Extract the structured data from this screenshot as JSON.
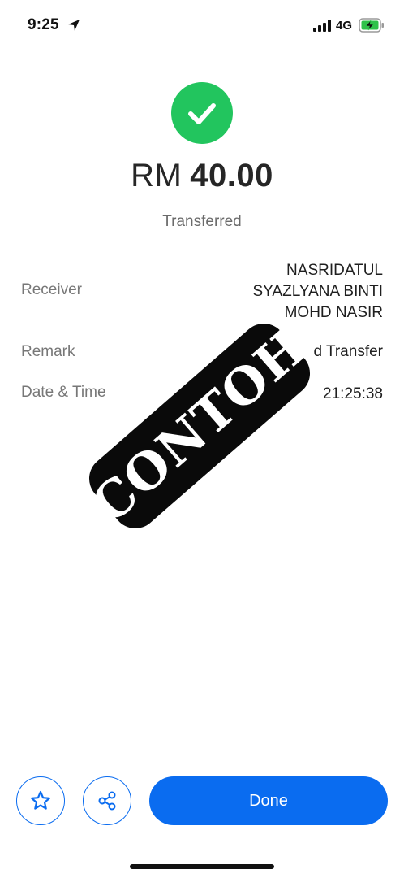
{
  "status_bar": {
    "time": "9:25",
    "network": "4G",
    "icons": [
      "location-arrow-icon",
      "signal-icon",
      "battery-charging-icon"
    ]
  },
  "transaction": {
    "currency": "RM",
    "amount": "40.00",
    "status": "Transferred",
    "success_color": "#22c55e"
  },
  "details": {
    "receiver_label": "Receiver",
    "receiver_lines": [
      "NASRIDATUL",
      "SYAZLYANA BINTI",
      "MOHD NASIR"
    ],
    "remark_label": "Remark",
    "remark_value_visible": "d Transfer",
    "datetime_label": "Date & Time",
    "datetime_value_visible": "21:25:38"
  },
  "watermark": {
    "text": "CONTOH"
  },
  "actions": {
    "favorite_icon": "star-icon",
    "share_icon": "share-icon",
    "done_label": "Done",
    "accent_color": "#0a6cf0"
  }
}
